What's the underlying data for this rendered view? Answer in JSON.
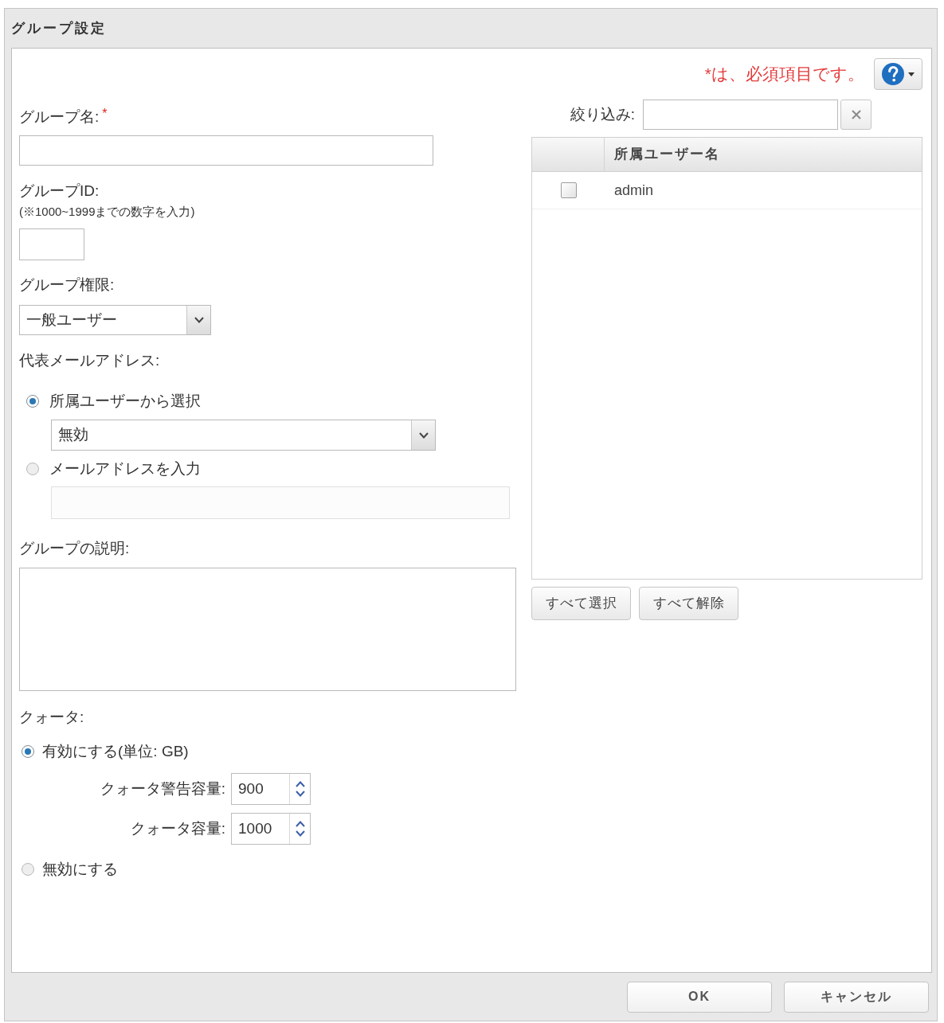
{
  "window": {
    "title": "グループ設定"
  },
  "required_note": "*は、必須項目です。",
  "group_name": {
    "label": "グループ名:",
    "required_mark": "*"
  },
  "group_id": {
    "label": "グループID:",
    "note": "(※1000~1999までの数字を入力)"
  },
  "group_permission": {
    "label": "グループ権限:",
    "value": "一般ユーザー"
  },
  "email": {
    "label": "代表メールアドレス:",
    "options": [
      {
        "label": "所属ユーザーから選択",
        "selected": true,
        "field": {
          "kind": "select",
          "value": "無効",
          "disabled": false
        }
      },
      {
        "label": "メールアドレスを入力",
        "selected": false,
        "field": {
          "kind": "text",
          "disabled": true
        }
      }
    ]
  },
  "description": {
    "label": "グループの説明:"
  },
  "quota": {
    "label": "クォータ:",
    "options": [
      {
        "label": "有効にする(単位: GB)",
        "selected": true,
        "spinners": [
          {
            "label": "クォータ警告容量:",
            "value": "900"
          },
          {
            "label": "クォータ容量:",
            "value": "1000"
          }
        ]
      },
      {
        "label": "無効にする",
        "selected": false
      }
    ]
  },
  "filter": {
    "label": "絞り込み:"
  },
  "members_table": {
    "columns": [
      "所属ユーザー名"
    ],
    "rows": [
      {
        "checked": false,
        "name": "admin"
      }
    ]
  },
  "member_buttons": [
    "すべて選択",
    "すべて解除"
  ],
  "footer_buttons": [
    "OK",
    "キャンセル"
  ]
}
